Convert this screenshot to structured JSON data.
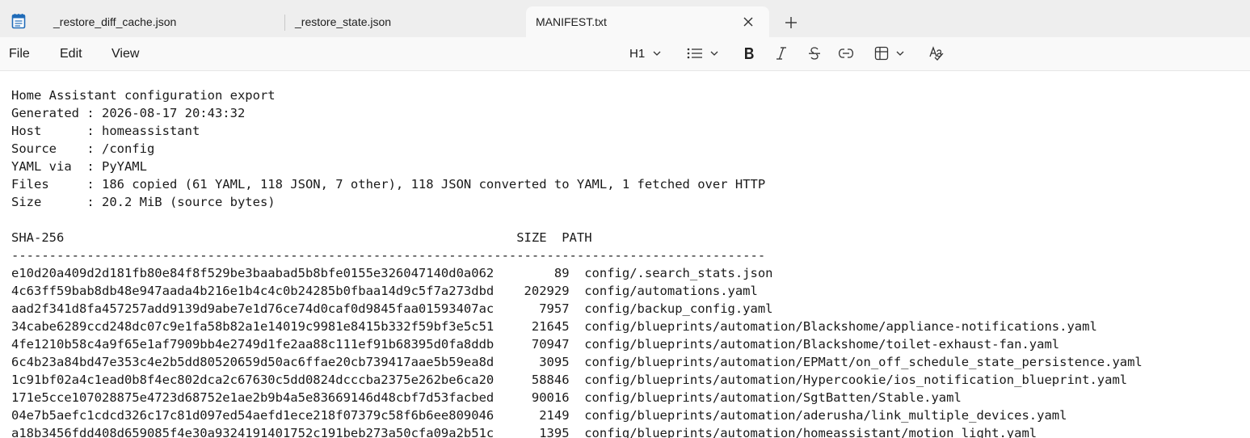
{
  "tabs": [
    {
      "label": "_restore_diff_cache.json",
      "active": false
    },
    {
      "label": "_restore_state.json",
      "active": false
    },
    {
      "label": "MANIFEST.txt",
      "active": true
    }
  ],
  "menu": {
    "file": "File",
    "edit": "Edit",
    "view": "View"
  },
  "toolbar": {
    "heading": "H1"
  },
  "document": {
    "lines": [
      "Home Assistant configuration export",
      "Generated : 2026-08-17 20:43:32",
      "Host      : homeassistant",
      "Source    : /config",
      "YAML via  : PyYAML",
      "Files     : 186 copied (61 YAML, 118 JSON, 7 other), 118 JSON converted to YAML, 1 fetched over HTTP",
      "Size      : 20.2 MiB (source bytes)",
      "",
      "SHA-256                                                            SIZE  PATH",
      "----------------------------------------------------------------------------------------------------",
      "e10d20a409d2d181fb80e84f8f529be3baabad5b8bfe0155e326047140d0a062        89  config/.search_stats.json",
      "4c63ff59bab8db48e947aada4b216e1b4c4c0b24285b0fbaa14d9c5f7a273dbd    202929  config/automations.yaml",
      "aad2f341d8fa457257add9139d9abe7e1d76ce74d0caf0d9845faa01593407ac      7957  config/backup_config.yaml",
      "34cabe6289ccd248dc07c9e1fa58b82a1e14019c9981e8415b332f59bf3e5c51     21645  config/blueprints/automation/Blackshome/appliance-notifications.yaml",
      "4fe1210b58c4a9f65e1af7909bb4e2749d1fe2aa88c111ef91b68395d0fa8ddb     70947  config/blueprints/automation/Blackshome/toilet-exhaust-fan.yaml",
      "6c4b23a84bd47e353c4e2b5dd80520659d50ac6ffae20cb739417aae5b59ea8d      3095  config/blueprints/automation/EPMatt/on_off_schedule_state_persistence.yaml",
      "1c91bf02a4c1ead0b8f4ec802dca2c67630c5dd0824dcccba2375e262be6ca20     58846  config/blueprints/automation/Hypercookie/ios_notification_blueprint.yaml",
      "171e5cce107028875e4723d68752e1ae2b9b4a5e83669146d48cbf7d53facbed     90016  config/blueprints/automation/SgtBatten/Stable.yaml",
      "04e7b5aefc1cdcd326c17c81d097ed54aefd1ece218f07379c58f6b6ee809046      2149  config/blueprints/automation/aderusha/link_multiple_devices.yaml",
      "a18b3456fdd408d659085f4e30a9324191401752c191beb273a50cfa09a2b51c      1395  config/blueprints/automation/homeassistant/motion_light.yaml"
    ]
  },
  "icons": {
    "app": "notepad-icon",
    "close": "close-icon",
    "new_tab": "plus-icon",
    "bold": "bold-icon",
    "italic": "italic-icon",
    "strike": "strikethrough-icon",
    "link": "link-icon",
    "table": "table-icon",
    "list": "bulleted-list-icon",
    "spell": "spellcheck-icon"
  },
  "colors": {
    "tabbar_bg": "#eeeeee",
    "active_tab_bg": "#f9f9f9",
    "app_icon": "#1f6bb8"
  }
}
